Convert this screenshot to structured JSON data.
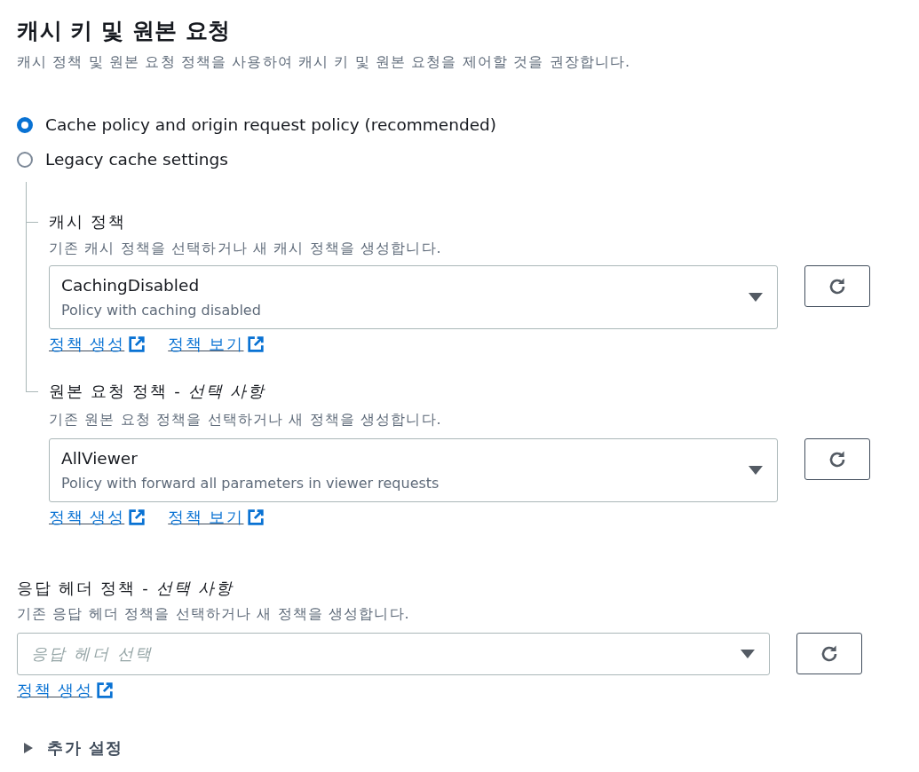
{
  "header": {
    "title": "캐시 키 및 원본 요청",
    "description": "캐시 정책 및 원본 요청 정책을 사용하여 캐시 키 및 원본 요청을 제어할 것을 권장합니다."
  },
  "settings_mode": [
    {
      "label": "Cache policy and origin request policy (recommended)",
      "selected": true
    },
    {
      "label": "Legacy cache settings",
      "selected": false
    }
  ],
  "policies": [
    {
      "label": "캐시 정책",
      "description": "기존 캐시 정책을 선택하거나 새 캐시 정책을 생성합니다.",
      "select": {
        "value": "CachingDisabled",
        "detail": "Policy with caching disabled"
      },
      "links": [
        "정책 생성",
        "정책 보기"
      ]
    },
    {
      "label": "원본 요청 정책 - *선택 사항*",
      "description": "기존 원본 요청 정책을 선택하거나 새 정책을 생성합니다.",
      "select": {
        "value": "AllViewer",
        "detail": "Policy with forward all parameters in viewer requests"
      },
      "links": [
        "정책 생성",
        "정책 보기"
      ]
    }
  ],
  "response_headers_policy": {
    "label": "응답 헤더 정책 - *선택 사항*",
    "description": "기존 응답 헤더 정책을 선택하거나 새 정책을 생성합니다.",
    "select": {
      "placeholder": "응답 헤더 선택"
    },
    "links": [
      "정책 생성"
    ]
  },
  "additional_settings": {
    "label": "추가 설정",
    "expanded": false
  }
}
